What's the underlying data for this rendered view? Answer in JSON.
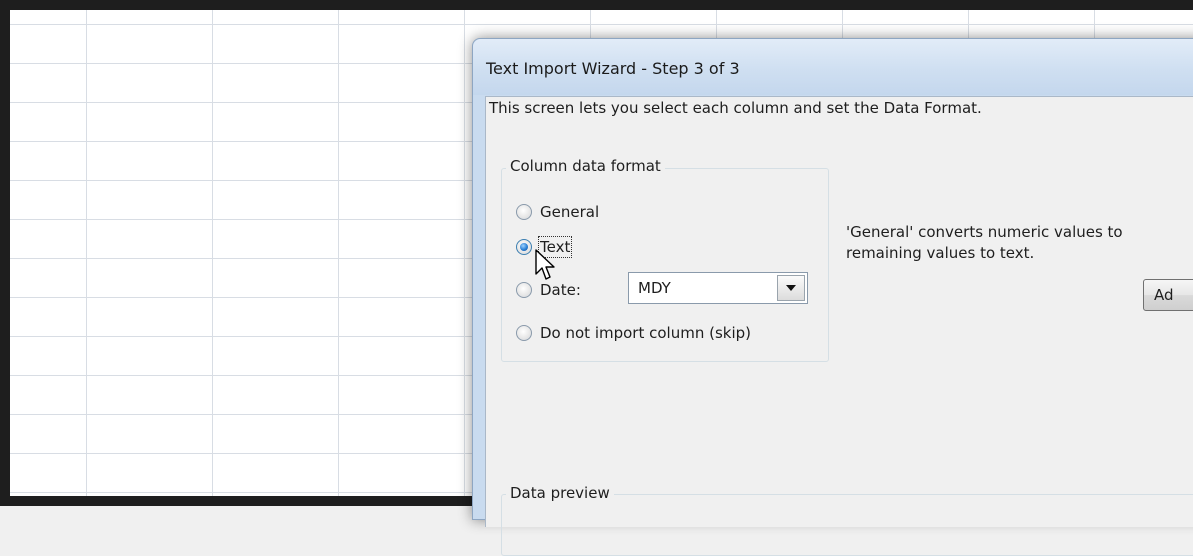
{
  "dialog": {
    "title": "Text Import Wizard - Step 3 of 3",
    "intro": "This screen lets you select each column and set the Data Format.",
    "column_format": {
      "legend": "Column data format",
      "options": [
        {
          "label": "General",
          "checked": false
        },
        {
          "label": "Text",
          "checked": true
        },
        {
          "label": "Date:",
          "checked": false
        },
        {
          "label": "Do not import column (skip)",
          "checked": false
        }
      ],
      "date_combo_value": "MDY"
    },
    "description_line1": "'General' converts numeric values to",
    "description_line2": "remaining values to text.",
    "advanced_button": "Ad",
    "data_preview_legend": "Data preview"
  }
}
